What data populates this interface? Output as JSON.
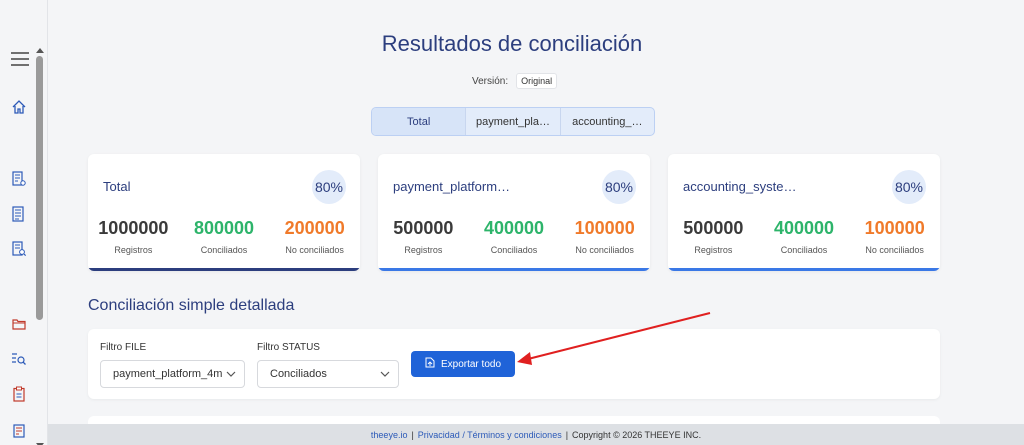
{
  "header": {
    "title": "Resultados de conciliación",
    "version_label": "Versión:",
    "version_value": "Original"
  },
  "tabs": [
    {
      "label": "Total",
      "active": true
    },
    {
      "label": "payment_pla…",
      "active": false
    },
    {
      "label": "accounting_…",
      "active": false
    }
  ],
  "cards": [
    {
      "title": "Total",
      "pct": "80%",
      "registros": "1000000",
      "conciliados": "800000",
      "no_conciliados": "200000",
      "accent": "#2c3e7e"
    },
    {
      "title": "payment_platform…",
      "pct": "80%",
      "registros": "500000",
      "conciliados": "400000",
      "no_conciliados": "100000",
      "accent": "#3a78e6"
    },
    {
      "title": "accounting_syste…",
      "pct": "80%",
      "registros": "500000",
      "conciliados": "400000",
      "no_conciliados": "100000",
      "accent": "#3a78e6"
    }
  ],
  "stat_labels": {
    "registros": "Registros",
    "conciliados": "Conciliados",
    "no_conciliados": "No conciliados"
  },
  "section": {
    "title": "Conciliación simple detallada"
  },
  "filters": {
    "file_label": "Filtro FILE",
    "file_value": "payment_platform_4m",
    "status_label": "Filtro STATUS",
    "status_value": "Conciliados",
    "export_label": "Exportar todo"
  },
  "footer": {
    "site": "theeye.io",
    "sep1": "|",
    "privacy": "Privacidad / Términos y condiciones",
    "sep2": "|",
    "copyright": "Copyright © 2026 THEEYE INC."
  },
  "colors": {
    "primary": "#2c3e7e",
    "button": "#1f63d8",
    "green": "#2db46a",
    "orange": "#f07a2a",
    "annotation": "#e02020"
  },
  "icons": {
    "menu": "hamburger-menu-icon",
    "home": "home-icon",
    "report1": "report-settings-icon",
    "report2": "report-list-icon",
    "report3": "report-search-icon",
    "folder": "folder-icon",
    "search_list": "list-search-icon",
    "clipboard": "clipboard-icon",
    "document": "document-icon"
  }
}
